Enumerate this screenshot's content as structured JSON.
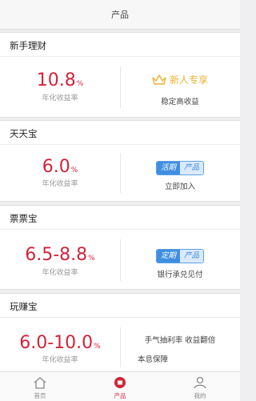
{
  "header": {
    "title": "产品"
  },
  "products": [
    {
      "name": "新手理财",
      "rate": "10.8",
      "rate_suffix": "%",
      "rate_label": "年化收益率",
      "right_badge": "新人专享",
      "right_sub": "稳定高收益"
    },
    {
      "name": "天天宝",
      "rate": "6.0",
      "rate_suffix": "%",
      "rate_label": "年化收益率",
      "tag_left": "活期",
      "tag_right": "产品",
      "right_sub": "立即加入"
    },
    {
      "name": "票票宝",
      "rate": "6.5-8.8",
      "rate_suffix": "%",
      "rate_label": "年化收益率",
      "tag_left": "定期",
      "tag_right": "产品",
      "right_sub": "银行承兑见付"
    },
    {
      "name": "玩赚宝",
      "rate": "6.0-10.0",
      "rate_suffix": "%",
      "rate_label": "年化收益率",
      "right_line1": "手气抽利率  收益翻倍",
      "right_line2": "本息保障"
    }
  ],
  "tabbar": {
    "home": "首页",
    "products": "产品",
    "mine": "我的"
  },
  "colors": {
    "accent": "#d0253a",
    "gold": "#e9b330",
    "blue": "#3f8fe0"
  }
}
